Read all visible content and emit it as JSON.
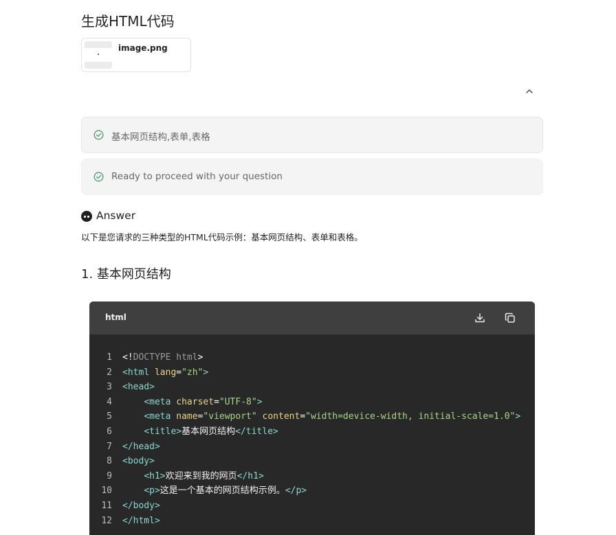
{
  "page": {
    "title": "生成HTML代码",
    "attachment": {
      "file_name": "image.png"
    },
    "steps": [
      {
        "label": "基本网页结构,表单,表格",
        "status_icon": "check-circle-icon"
      },
      {
        "label": "Ready to proceed with your question",
        "status_icon": "check-circle-icon"
      }
    ],
    "answer": {
      "title": "Answer",
      "description": "以下是您请求的三种类型的HTML代码示例：基本网页结构、表单和表格。",
      "section_heading": "1. 基本网页结构"
    },
    "code_block": {
      "language": "html",
      "buttons": {
        "download": "download-icon",
        "copy": "copy-icon"
      },
      "lines": [
        {
          "n": "1",
          "segs": [
            [
              "p",
              "<"
            ],
            [
              "p",
              "!"
            ],
            [
              "d",
              "DOCTYPE "
            ],
            [
              "d",
              "html"
            ],
            [
              "p",
              ">"
            ]
          ]
        },
        {
          "n": "2",
          "segs": [
            [
              "t",
              "<html "
            ],
            [
              "a",
              "lang"
            ],
            [
              "p",
              "="
            ],
            [
              "s",
              "\"zh\""
            ],
            [
              "t",
              ">"
            ]
          ]
        },
        {
          "n": "3",
          "segs": [
            [
              "t",
              "<head>"
            ]
          ]
        },
        {
          "n": "4",
          "segs": [
            [
              "p",
              "    "
            ],
            [
              "t",
              "<meta "
            ],
            [
              "a",
              "charset"
            ],
            [
              "p",
              "="
            ],
            [
              "s",
              "\"UTF-8\""
            ],
            [
              "t",
              ">"
            ]
          ]
        },
        {
          "n": "5",
          "segs": [
            [
              "p",
              "    "
            ],
            [
              "t",
              "<meta "
            ],
            [
              "a",
              "name"
            ],
            [
              "p",
              "="
            ],
            [
              "s",
              "\"viewport\" "
            ],
            [
              "a",
              "content"
            ],
            [
              "p",
              "="
            ],
            [
              "s",
              "\"width=device-width, initial-scale=1.0\""
            ],
            [
              "t",
              ">"
            ]
          ]
        },
        {
          "n": "6",
          "segs": [
            [
              "p",
              "    "
            ],
            [
              "t",
              "<title>"
            ],
            [
              "x",
              "基本网页结构"
            ],
            [
              "t",
              "</title>"
            ]
          ]
        },
        {
          "n": "7",
          "segs": [
            [
              "t",
              "</head>"
            ]
          ]
        },
        {
          "n": "8",
          "segs": [
            [
              "t",
              "<body>"
            ]
          ]
        },
        {
          "n": "9",
          "segs": [
            [
              "p",
              "    "
            ],
            [
              "t",
              "<h1>"
            ],
            [
              "x",
              "欢迎来到我的网页"
            ],
            [
              "t",
              "</h1>"
            ]
          ]
        },
        {
          "n": "10",
          "segs": [
            [
              "p",
              "    "
            ],
            [
              "t",
              "<p>"
            ],
            [
              "x",
              "这是一个基本的网页结构示例。"
            ],
            [
              "t",
              "</p>"
            ]
          ]
        },
        {
          "n": "11",
          "segs": [
            [
              "t",
              "</body>"
            ]
          ]
        },
        {
          "n": "12",
          "segs": [
            [
              "t",
              "</html>"
            ]
          ]
        }
      ]
    }
  },
  "colors": {
    "code_bg": "#282828",
    "code_header_bg": "#3f3f3f",
    "tag": "#89d9d1",
    "attr": "#e8d58a",
    "string": "#a9d68a",
    "step_bg": "#f4f4f4",
    "check": "#4a9a72"
  }
}
